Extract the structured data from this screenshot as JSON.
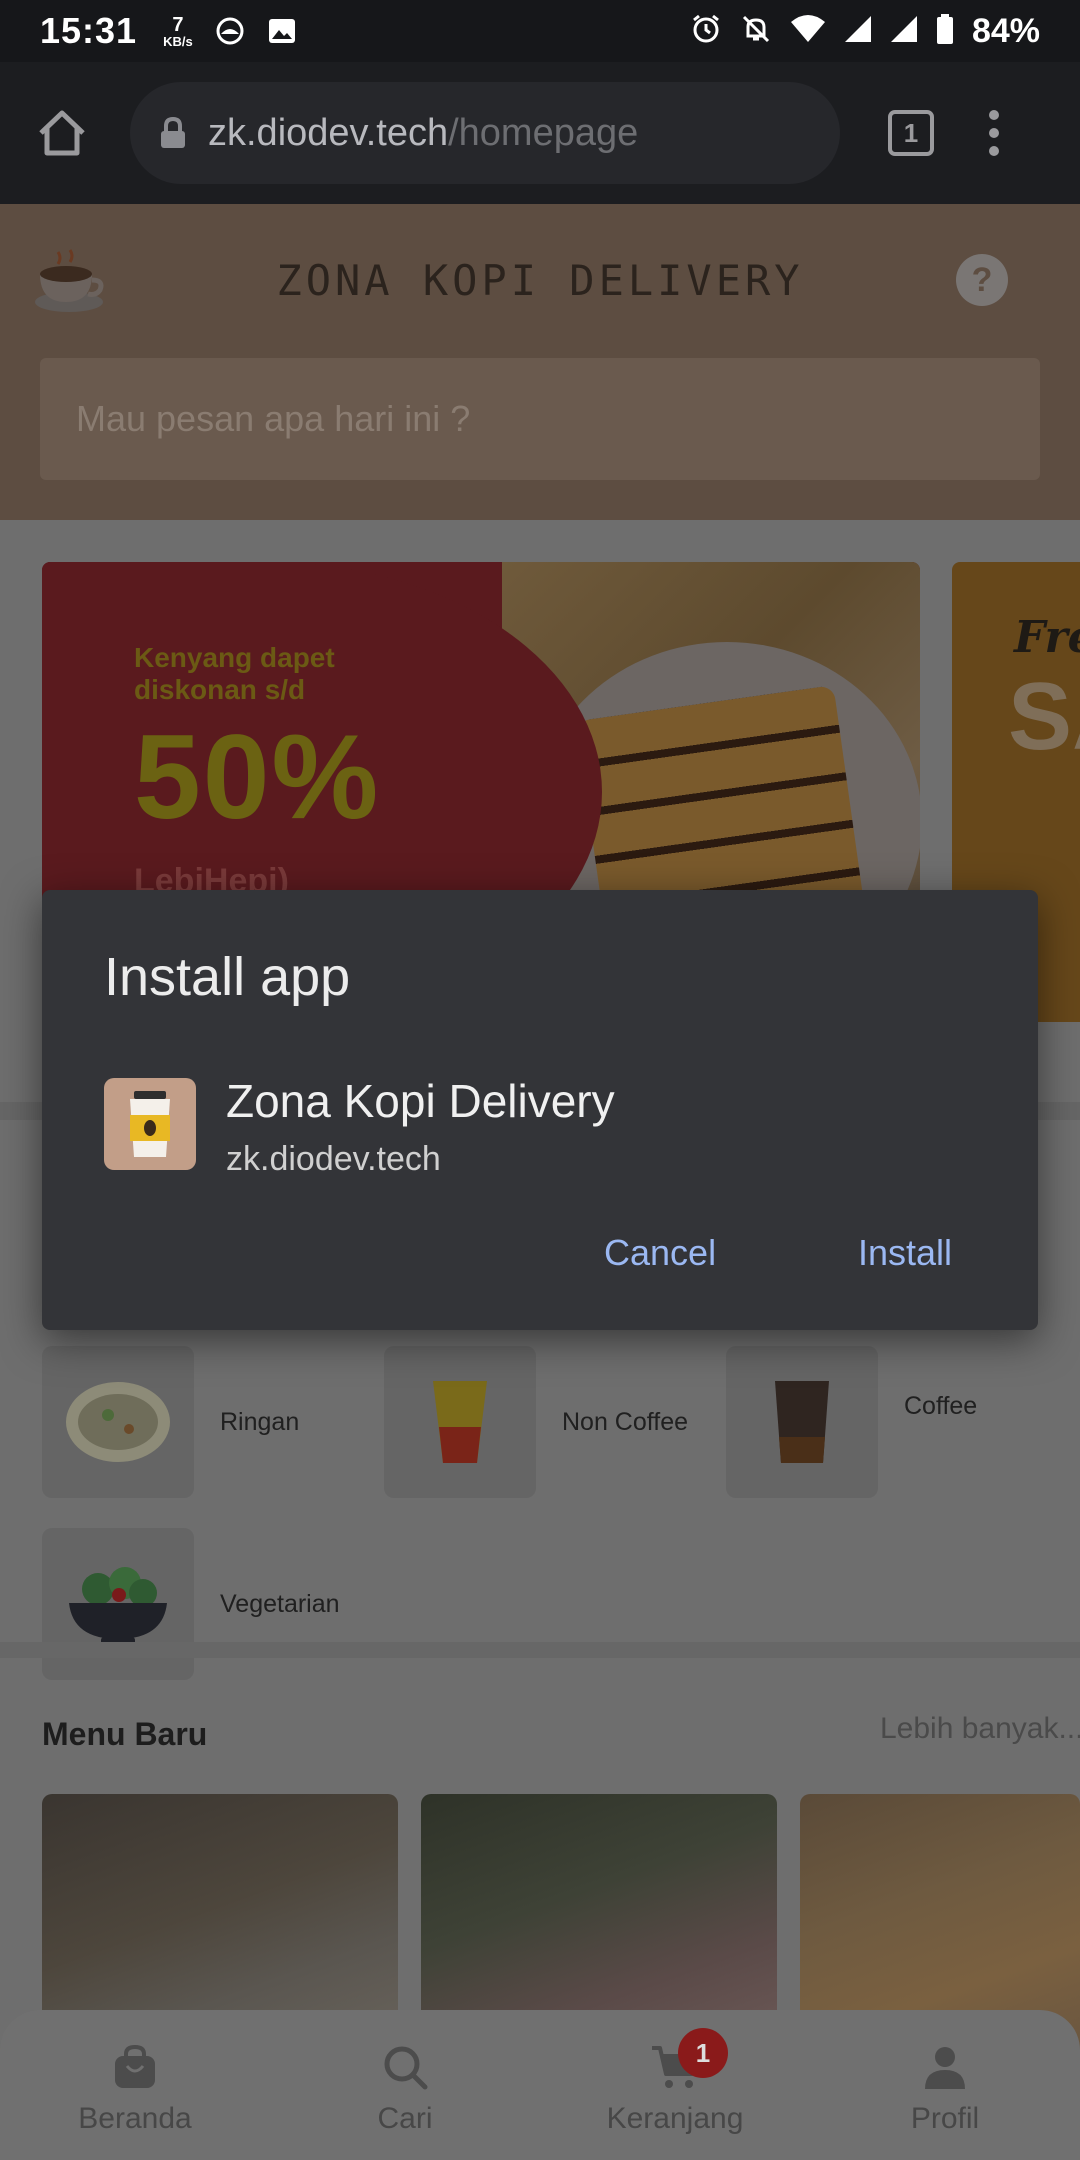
{
  "status_bar": {
    "time": "15:31",
    "net_speed_value": "7",
    "net_speed_unit": "KB/s",
    "battery": "84%"
  },
  "browser": {
    "url_host": "zk.diodev.tech",
    "url_path": "/homepage",
    "tab_count": "1"
  },
  "header": {
    "title": "ZONA KOPI DELIVERY",
    "search_placeholder": "Mau pesan apa hari ini ?",
    "help_label": "?"
  },
  "banners": [
    {
      "line1": "Kenyang dapet",
      "line2": "diskonan s/d",
      "percent": "50%",
      "brand": "LebiHepi)"
    },
    {
      "word1": "Fre",
      "word2": "SA"
    }
  ],
  "categories": [
    {
      "label": "Ringan",
      "icon": "snack-plate-icon"
    },
    {
      "label": "Non Coffee",
      "icon": "juice-glass-icon"
    },
    {
      "label": "Coffee",
      "icon": "coffee-cup-icon"
    },
    {
      "label": "Vegetarian",
      "icon": "salad-bowl-icon"
    }
  ],
  "menu_baru": {
    "title": "Menu Baru",
    "more": "Lebih banyak..."
  },
  "bottom_nav": [
    {
      "label": "Beranda",
      "icon": "shopping-bag-icon"
    },
    {
      "label": "Cari",
      "icon": "search-icon"
    },
    {
      "label": "Keranjang",
      "icon": "cart-icon",
      "badge": "1"
    },
    {
      "label": "Profil",
      "icon": "person-icon"
    }
  ],
  "dialog": {
    "title": "Install app",
    "app_name": "Zona Kopi Delivery",
    "app_url": "zk.diodev.tech",
    "cancel": "Cancel",
    "install": "Install"
  },
  "colors": {
    "dialog_bg": "#333438",
    "dialog_button": "#9bb8f2",
    "header_dimmed": "#5d4d41",
    "badge": "#8a1a1a"
  }
}
